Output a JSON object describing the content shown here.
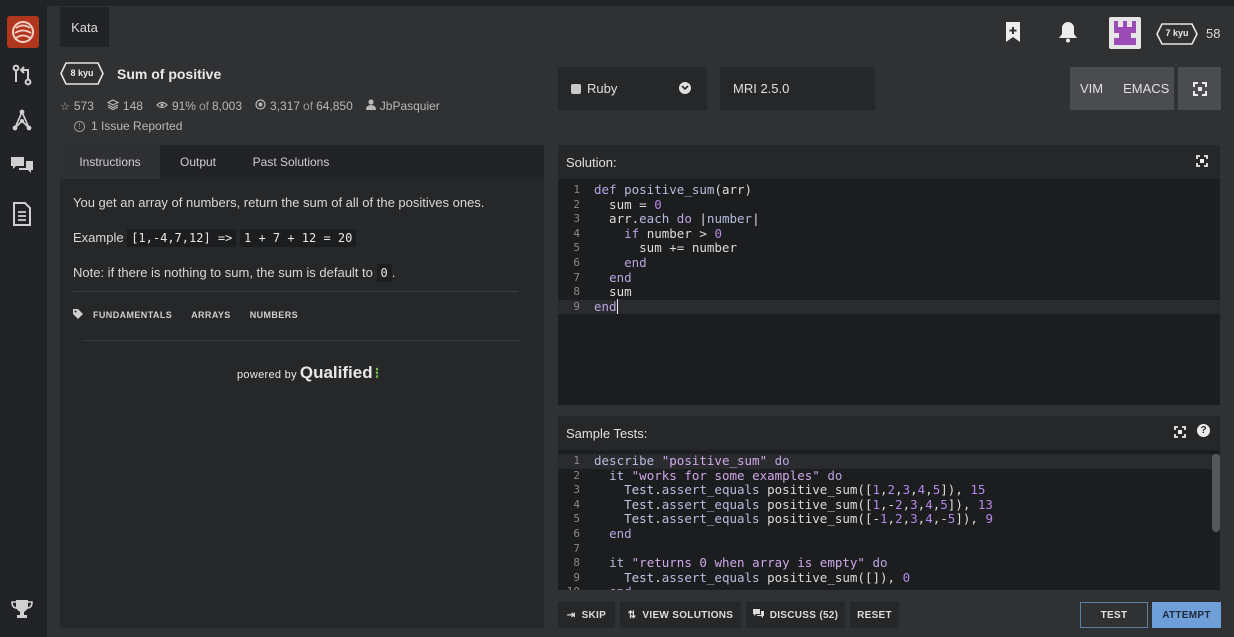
{
  "header": {
    "kata_tab": "Kata",
    "user_rank": "7 kyu",
    "honor": "58"
  },
  "kata": {
    "rank": "8 kyu",
    "title": "Sum of positive",
    "stars": "573",
    "collections": "148",
    "satisfaction": "91%",
    "satisfaction_of": "of",
    "satisfaction_total": "8,003",
    "completed": "3,317",
    "completed_of": "of",
    "completed_total": "64,850",
    "author": "JbPasquier",
    "issues": "1 Issue Reported"
  },
  "editor_settings": {
    "language": "Ruby",
    "version": "MRI 2.5.0",
    "modes": [
      "VIM",
      "EMACS"
    ]
  },
  "tabs": [
    "Instructions",
    "Output",
    "Past Solutions"
  ],
  "instructions": {
    "line1": "You get an array of numbers, return the sum of all of the positives ones.",
    "example_label": "Example",
    "example_input": "[1,-4,7,12]",
    "example_arrow": "=>",
    "example_output": "1 + 7 + 12 = 20",
    "note_text": "Note: if there is nothing to sum, the sum is default to",
    "note_code": "0",
    "note_end": ".",
    "tags": [
      "FUNDAMENTALS",
      "ARRAYS",
      "NUMBERS"
    ],
    "powered_by": "powered by",
    "qualified": "Qualified"
  },
  "solution": {
    "label": "Solution:",
    "lines": [
      "def positive_sum(arr)",
      "  sum = 0",
      "  arr.each do |number|",
      "    if number > 0",
      "      sum += number",
      "    end",
      "  end",
      "  sum",
      "end"
    ]
  },
  "tests": {
    "label": "Sample Tests:",
    "lines": [
      "describe \"positive_sum\" do",
      "  it \"works for some examples\" do",
      "    Test.assert_equals positive_sum([1,2,3,4,5]), 15",
      "    Test.assert_equals positive_sum([1,-2,3,4,5]), 13",
      "    Test.assert_equals positive_sum([-1,2,3,4,-5]), 9",
      "  end",
      "",
      "  it \"returns 0 when array is empty\" do",
      "    Test.assert_equals positive_sum([]), 0",
      "  end"
    ]
  },
  "buttons": {
    "skip": "SKIP",
    "view_solutions": "VIEW SOLUTIONS",
    "discuss": "DISCUSS (52)",
    "reset": "RESET",
    "test": "TEST",
    "attempt": "ATTEMPT"
  }
}
